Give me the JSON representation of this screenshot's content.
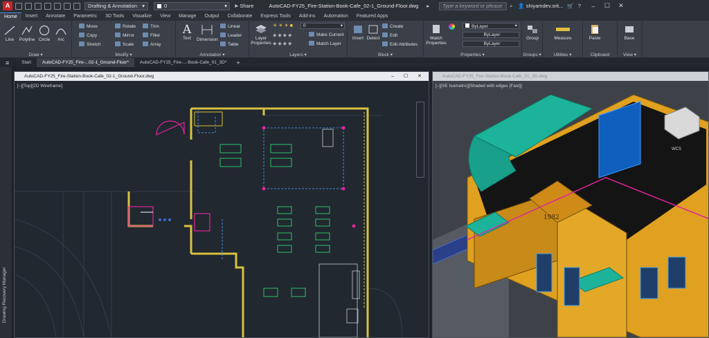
{
  "app": {
    "title_doc": "AutoCAD-FY25_Fire-Station-Book-Cafe_02-1_Ground-Floor.dwg",
    "icon_letter": "A",
    "workspace": "Drafting & Annotation",
    "layer_quick": "0",
    "share": "Share",
    "search_placeholder": "Type a keyword or phrase",
    "user": "shiyamdev.srit..."
  },
  "ribbon_tabs": [
    "Home",
    "Insert",
    "Annotate",
    "Parametric",
    "3D Tools",
    "Visualize",
    "View",
    "Manage",
    "Output",
    "Collaborate",
    "Express Tools",
    "Add-ins",
    "Automation",
    "Featured Apps"
  ],
  "panels": {
    "draw": {
      "title": "Draw",
      "line": "Line",
      "polyline": "Polyline",
      "circle": "Circle",
      "arc": "Arc"
    },
    "modify": {
      "title": "Modify",
      "move": "Move",
      "rotate": "Rotate",
      "trim": "Trim",
      "copy": "Copy",
      "mirror": "Mirror",
      "fillet": "Fillet",
      "stretch": "Stretch",
      "scale": "Scale",
      "array": "Array"
    },
    "annotation": {
      "title": "Annotation",
      "text": "Text",
      "dimension": "Dimension",
      "linear": "Linear",
      "leader": "Leader",
      "table": "Table"
    },
    "layers": {
      "title": "Layers",
      "layer_properties": "Layer Properties",
      "current_layer": "0",
      "make_current": "Make Current",
      "match_layer": "Match Layer"
    },
    "block": {
      "title": "Block",
      "insert": "Insert",
      "create": "Create",
      "edit": "Edit",
      "edit_attributes": "Edit Attributes"
    },
    "detect": "Detect",
    "properties": {
      "title": "Properties",
      "match_properties": "Match Properties",
      "color": "ByLayer",
      "linetype": "ByLayer",
      "lineweight": "ByLayer"
    },
    "groups": {
      "title": "Groups",
      "group": "Group"
    },
    "utilities": {
      "title": "Utilities",
      "measure": "Measure"
    },
    "clipboard": {
      "title": "Clipboard",
      "paste": "Paste"
    },
    "view": {
      "title": "View",
      "base": "Base"
    }
  },
  "file_tabs": [
    "Start",
    "AutoCAD-FY25_Fire-...02-1_Ground-Floor*",
    "AutoCAD-FY25_Fire-...-Book-Cafe_01_3D*"
  ],
  "sidebar_label": "Drawing Recovery Manager",
  "viewports": {
    "left": {
      "title": "AutoCAD-FY25_Fire-Station-Book-Cafe_02-1_Ground-Floor.dwg",
      "label": "[–][Top][2D Wireframe]"
    },
    "right": {
      "title": "AutoCAD-FY25_Fire-Station-Book-Cafe_01_3D.dwg",
      "label": "[–][SE Isometric][Shaded with edges [Fast]]",
      "year": "1982",
      "cube": "WCS"
    }
  },
  "colors": {
    "accent": "#4a90e2",
    "wall": "#d8c240",
    "furniture": "#2fbf6a",
    "magenta": "#e0259a",
    "building": "#e0a020",
    "roof": "#1db39b"
  }
}
